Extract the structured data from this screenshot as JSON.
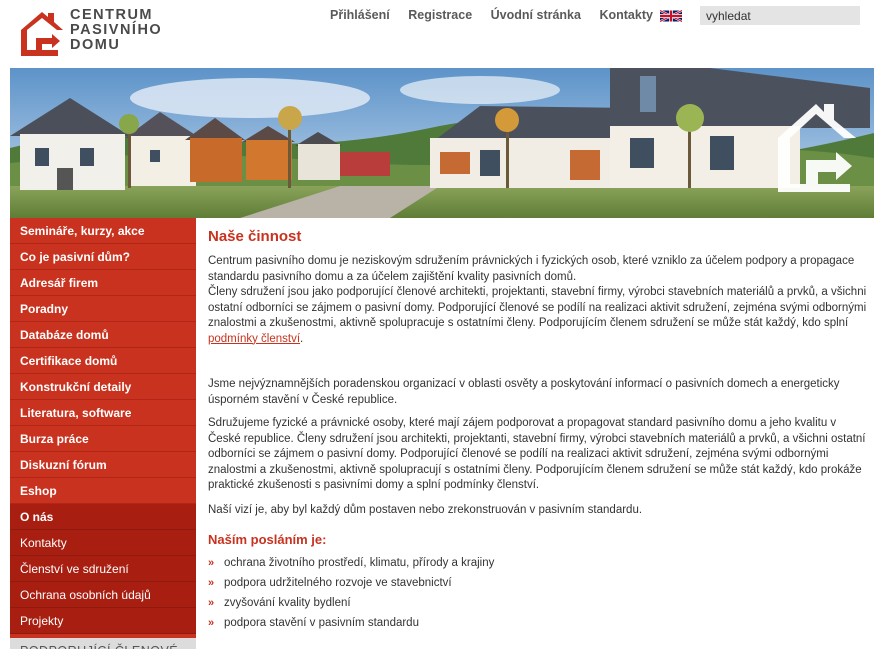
{
  "logo": {
    "lines": [
      "CENTRUM",
      "PASIVNÍHO",
      "DOMU"
    ]
  },
  "topnav": [
    "Přihlášení",
    "Registrace",
    "Úvodní stránka",
    "Kontakty"
  ],
  "search": {
    "value": "vyhledat"
  },
  "sidebar": {
    "primary": [
      "Semináře, kurzy, akce",
      "Co je pasivní dům?",
      "Adresář firem",
      "Poradny",
      "Databáze domů",
      "Certifikace domů",
      "Konstrukční detaily",
      "Literatura, software",
      "Burza práce",
      "Diskuzní fórum",
      "Eshop"
    ],
    "secondary_title": "O nás",
    "secondary": [
      "Kontakty",
      "Členství ve sdružení",
      "Ochrana osobních údajů",
      "Projekty"
    ],
    "members": "PODPORUJÍCÍ ČLENOVÉ"
  },
  "content": {
    "title": "Naše činnost",
    "p1a": "Centrum pasivního domu je neziskovým sdružením právnických i fyzických osob, které vzniklo za účelem podpory a propagace standardu pasivního domu a za účelem zajištění kvality pasivních domů.",
    "p1b": "Členy sdružení jsou jako podporující členové architekti, projektanti, stavební firmy, výrobci stavebních materiálů a prvků, a všichni ostatní odborníci se zájmem o pasivní domy. Podporující členové se podílí na realizaci aktivit sdružení, zejména svými odbornými znalostmi a zkušenostmi, aktivně spolupracuje s ostatními členy. Podporujícím členem sdružení se může stát každý, kdo splní ",
    "p1_link": "podmínky členství",
    "p1_end": ".",
    "p2": "Jsme nejvýznamnějších poradenskou organizací v oblasti osvěty a poskytování informací o pasivních domech a energeticky úsporném stavění v České republice.",
    "p3": "Sdružujeme fyzické a právnické osoby, které mají zájem podporovat a propagovat standard pasivního domu a jeho kvalitu v České republice. Členy sdružení jsou architekti, projektanti, stavební firmy, výrobci stavebních materiálů a prvků, a všichni ostatní odborníci se zájmem o pasivní domy. Podporující členové se podílí na realizaci aktivit sdružení, zejména svými odbornými znalostmi a zkušenostmi, aktivně spolupracují s ostatními členy. Podporujícím členem sdružení se může stát každý, kdo prokáže praktické zkušenosti s pasivními domy a splní podmínky členství.",
    "p4": "Naší vizí je, aby byl každý dům postaven nebo zrekonstruován v pasivním standardu.",
    "mission_title": "Naším posláním je:",
    "bullet_glyph": "»",
    "mission": [
      "ochrana životního prostředí, klimatu, přírody a krajiny",
      "podpora udržitelného rozvoje ve stavebnictví",
      "zvyšování kvality bydlení",
      "podpora stavění v pasivním standardu"
    ]
  },
  "colors": {
    "accent": "#c8321f",
    "accent_dark": "#a81f12",
    "text": "#333333"
  }
}
